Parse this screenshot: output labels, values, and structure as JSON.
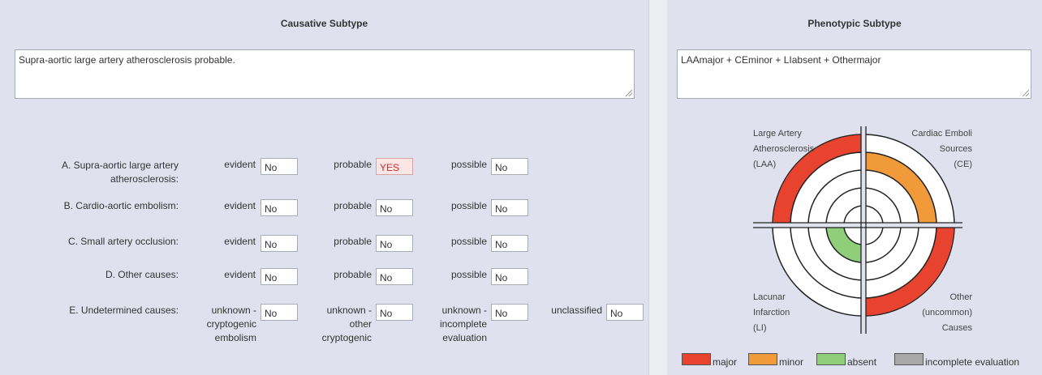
{
  "causative": {
    "title": "Causative Subtype",
    "summary": "Supra-aortic large artery atherosclerosis probable.",
    "rows": [
      {
        "label": "A. Supra-aortic large artery atherosclerosis:",
        "evident_label": "evident",
        "evident": "No",
        "probable_label": "probable",
        "probable": "YES",
        "possible_label": "possible",
        "possible": "No"
      },
      {
        "label": "B. Cardio-aortic embolism:",
        "evident_label": "evident",
        "evident": "No",
        "probable_label": "probable",
        "probable": "No",
        "possible_label": "possible",
        "possible": "No"
      },
      {
        "label": "C. Small artery occlusion:",
        "evident_label": "evident",
        "evident": "No",
        "probable_label": "probable",
        "probable": "No",
        "possible_label": "possible",
        "possible": "No"
      },
      {
        "label": "D. Other causes:",
        "evident_label": "evident",
        "evident": "No",
        "probable_label": "probable",
        "probable": "No",
        "possible_label": "possible",
        "possible": "No"
      }
    ],
    "undetermined": {
      "label": "E. Undetermined causes:",
      "c1_label": "unknown - cryptogenic embolism",
      "c1": "No",
      "c2_label": "unknown - other cryptogenic",
      "c2": "No",
      "c3_label": "unknown - incomplete evaluation",
      "c3": "No",
      "c4_label": "unclassified",
      "c4": "No"
    }
  },
  "phenotypic": {
    "title": "Phenotypic Subtype",
    "summary": "LAAmajor + CEminor + LIabsent + Othermajor",
    "quadrants": {
      "laa": {
        "line1": "Large Artery",
        "line2": "Atherosclerosis",
        "line3": "(LAA)",
        "status": "major"
      },
      "ce": {
        "line1": "Cardiac Emboli",
        "line2": "Sources",
        "line3": "(CE)",
        "status": "minor"
      },
      "li": {
        "line1": "Lacunar",
        "line2": "Infarction",
        "line3": "(LI)",
        "status": "absent"
      },
      "other": {
        "line1": "Other",
        "line2": "(uncommon)",
        "line3": "Causes",
        "status": "major"
      }
    },
    "legend": [
      {
        "label": "major",
        "color": "#e8432e"
      },
      {
        "label": "minor",
        "color": "#f09a3a"
      },
      {
        "label": "absent",
        "color": "#8fcf7a"
      },
      {
        "label": "incomplete evaluation",
        "color": "#a8a8a8"
      }
    ]
  }
}
